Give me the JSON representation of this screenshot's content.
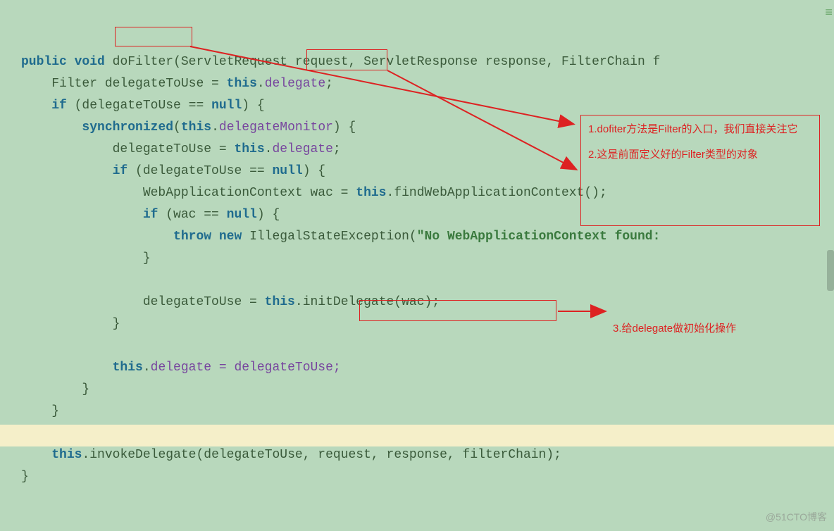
{
  "code": {
    "kw_public": "public",
    "kw_void": "void",
    "method_doFilter": "doFilter",
    "sig_rest": "(ServletRequest request, ServletResponse response, FilterChain f",
    "type_Filter": "Filter",
    "var_delegateToUse": " delegateToUse = ",
    "kw_this": "this",
    "dot": ".",
    "field_delegate": "delegate",
    "semicolon": ";",
    "kw_if": "if",
    "cond_open": " (delegateToUse == ",
    "kw_null": "null",
    "cond_close": ") {",
    "kw_synchronized": "synchronized",
    "sync_open": "(",
    "field_delegateMonitor": "delegateMonitor",
    "sync_close": ") {",
    "assign_delegateToUse": "delegateToUse = ",
    "type_wac": "WebApplicationContext wac = ",
    "method_findWac": "findWebApplicationContext();",
    "if_wac": " (wac == ",
    "kw_throw": "throw",
    "kw_new": "new",
    "type_IllegalState": " IllegalStateException(",
    "string_noWac": "\"No WebApplicationContext found:",
    "brace_close": "}",
    "method_initDelegate": "initDelegate(wac);",
    "assign_back": "delegate = delegateToUse;",
    "invoke": "invokeDelegate(delegateToUse, request, response, filterChain);"
  },
  "annotations": {
    "note1": "1.dofiter方法是Filter的入口，我们直接关注它",
    "note2": "2.这是前面定义好的Filter类型的对象",
    "note3": "3.给delegate做初始化操作"
  },
  "watermark": "@51CTO博客"
}
